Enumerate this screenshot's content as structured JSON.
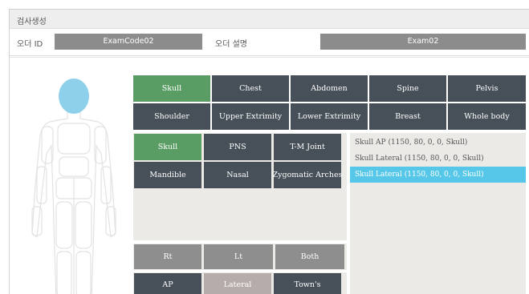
{
  "window": {
    "title": "검사생성"
  },
  "order": {
    "id_label": "오더 ID",
    "id_value": "ExamCode02",
    "desc_label": "오더 설명",
    "desc_value": "Exam02"
  },
  "regions": {
    "row1": [
      "Skull",
      "Chest",
      "Abdomen",
      "Spine",
      "Pelvis"
    ],
    "row2": [
      "Shoulder",
      "Upper Extrimity",
      "Lower Extrimity",
      "Breast",
      "Whole body"
    ],
    "selected": "Skull"
  },
  "sub_regions": {
    "row1": [
      "Skull",
      "PNS",
      "T-M Joint"
    ],
    "row2": [
      "Mandible",
      "Nasal",
      "Zygomatic Arches"
    ],
    "selected": "Skull"
  },
  "exams": {
    "items": [
      "Skull AP (1150, 80, 0, 0, Skull)",
      "Skull Lateral (1150, 80, 0, 0, Skull)",
      "Skull Lateral (1150, 80, 0, 0, Skull)"
    ],
    "selected_index": 2
  },
  "laterality": {
    "options": [
      "Rt",
      "Lt",
      "Both"
    ]
  },
  "projection": {
    "options": [
      "AP",
      "Lateral",
      "Town's"
    ],
    "selected": "Lateral"
  },
  "colors": {
    "dark_button": "#475059",
    "selected_green": "#5a9d64",
    "neutral_gray": "#8e8e8e",
    "selected_tan": "#b6adab",
    "list_selected": "#56c7e8",
    "head_blue": "#8ecfea"
  }
}
